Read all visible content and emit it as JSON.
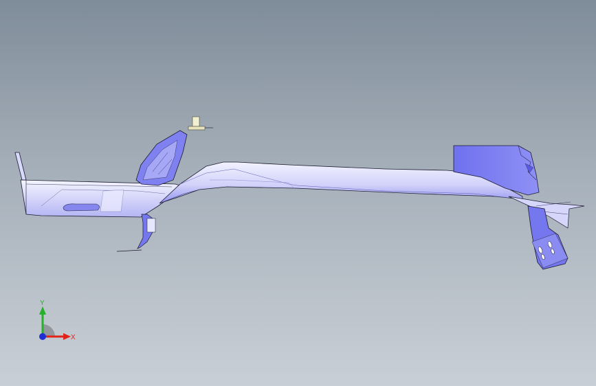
{
  "viewport": {
    "background_top": "#7f8c99",
    "background_bottom": "#c9cfd6",
    "part_color": "#7c7ef2",
    "part_highlight": "#ebebff",
    "edge_color": "#1a1a2e"
  },
  "triad": {
    "x_label": "X",
    "y_label": "Y",
    "x_color": "#e0241b",
    "y_color": "#27b02a",
    "z_color": "#1f2fd6"
  }
}
